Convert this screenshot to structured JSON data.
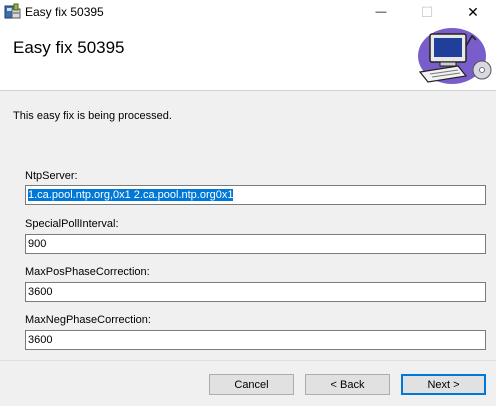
{
  "window": {
    "title": "Easy fix 50395",
    "min_glyph": "—",
    "max_glyph": "☐",
    "close_glyph": "✕"
  },
  "header": {
    "title": "Easy fix 50395",
    "graphic_icon": "computer-setup-icon"
  },
  "content": {
    "status": "This easy fix is being processed.",
    "fields": [
      {
        "label": "NtpServer:",
        "value": "1.ca.pool.ntp.org,0x1 2.ca.pool.ntp.org0x1",
        "selected": true
      },
      {
        "label": "SpecialPollInterval:",
        "value": "900"
      },
      {
        "label": "MaxPosPhaseCorrection:",
        "value": "3600"
      },
      {
        "label": "MaxNegPhaseCorrection:",
        "value": "3600"
      }
    ]
  },
  "footer": {
    "cancel_label": "Cancel",
    "back_label": "< Back",
    "next_label": "Next >"
  },
  "colors": {
    "accent": "#0078d7",
    "panel": "#f0f0f0"
  }
}
